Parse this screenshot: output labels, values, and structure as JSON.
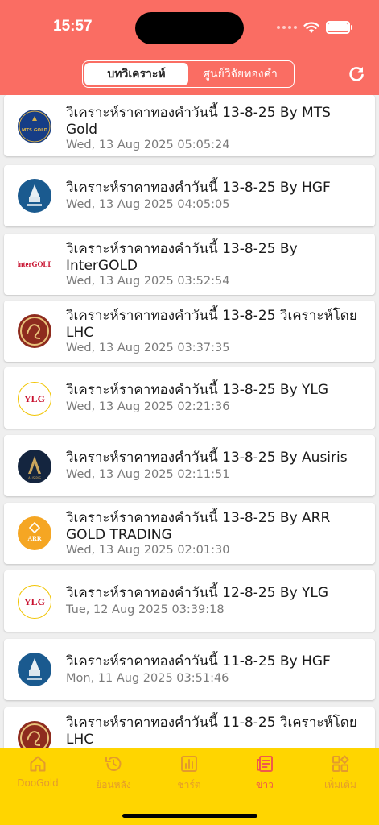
{
  "status": {
    "time": "15:57"
  },
  "segment": {
    "tabs": [
      "บทวิเคราะห์",
      "ศูนย์วิจัยทองคำ"
    ],
    "active": 0
  },
  "articles": [
    {
      "logo": "mts-gold-logo",
      "brand_text": "MTS GOLD",
      "title": "วิเคราะห์ราคาทองคำวันนี้ 13-8-25 By MTS Gold",
      "date": "Wed, 13 Aug 2025 05:05:24"
    },
    {
      "logo": "hgf-logo",
      "brand_text": "",
      "title": "วิเคราะห์ราคาทองคำวันนี้ 13-8-25 By HGF",
      "date": "Wed, 13 Aug 2025 04:05:05"
    },
    {
      "logo": "intergold-logo",
      "brand_text": "InterGOLD",
      "title": "วิเคราะห์ราคาทองคำวันนี้ 13-8-25 By InterGOLD",
      "date": "Wed, 13 Aug 2025 03:52:54"
    },
    {
      "logo": "lhc-logo",
      "brand_text": "",
      "title": "วิเคราะห์ราคาทองคำวันนี้ 13-8-25 วิเคราะห์โดย LHC",
      "date": "Wed, 13 Aug 2025 03:37:35"
    },
    {
      "logo": "ylg-logo",
      "brand_text": "YLG",
      "title": "วิเคราะห์ราคาทองคำวันนี้ 13-8-25 By YLG",
      "date": "Wed, 13 Aug 2025 02:21:36"
    },
    {
      "logo": "ausiris-logo",
      "brand_text": "AUSIRIS",
      "title": "วิเคราะห์ราคาทองคำวันนี้ 13-8-25 By Ausiris",
      "date": "Wed, 13 Aug 2025 02:11:51"
    },
    {
      "logo": "arr-logo",
      "brand_text": "ARR",
      "title": "วิเคราะห์ราคาทองคำวันนี้ 13-8-25 By ARR GOLD TRADING",
      "date": "Wed, 13 Aug 2025 02:01:30"
    },
    {
      "logo": "ylg-logo",
      "brand_text": "YLG",
      "title": "วิเคราะห์ราคาทองคำวันนี้ 12-8-25 By YLG",
      "date": "Tue, 12 Aug 2025 03:39:18"
    },
    {
      "logo": "hgf-logo",
      "brand_text": "",
      "title": "วิเคราะห์ราคาทองคำวันนี้ 11-8-25 By HGF",
      "date": "Mon, 11 Aug 2025 03:51:46"
    },
    {
      "logo": "lhc-logo",
      "brand_text": "",
      "title": "วิเคราะห์ราคาทองคำวันนี้ 11-8-25 วิเคราะห์โดย LHC",
      "date": ""
    }
  ],
  "tabbar": [
    {
      "label": "DooGold",
      "icon": "home-icon"
    },
    {
      "label": "ย้อนหลัง",
      "icon": "history-icon"
    },
    {
      "label": "ชาร์ต",
      "icon": "chart-icon"
    },
    {
      "label": "ข่าว",
      "icon": "news-icon",
      "active": true
    },
    {
      "label": "เพิ่มเติม",
      "icon": "more-grid-icon"
    }
  ],
  "colors": {
    "header": "#fa6d63",
    "tabbar": "#ffd500",
    "tab_inactive": "#e39b2c",
    "tab_active": "#f05a4b"
  }
}
